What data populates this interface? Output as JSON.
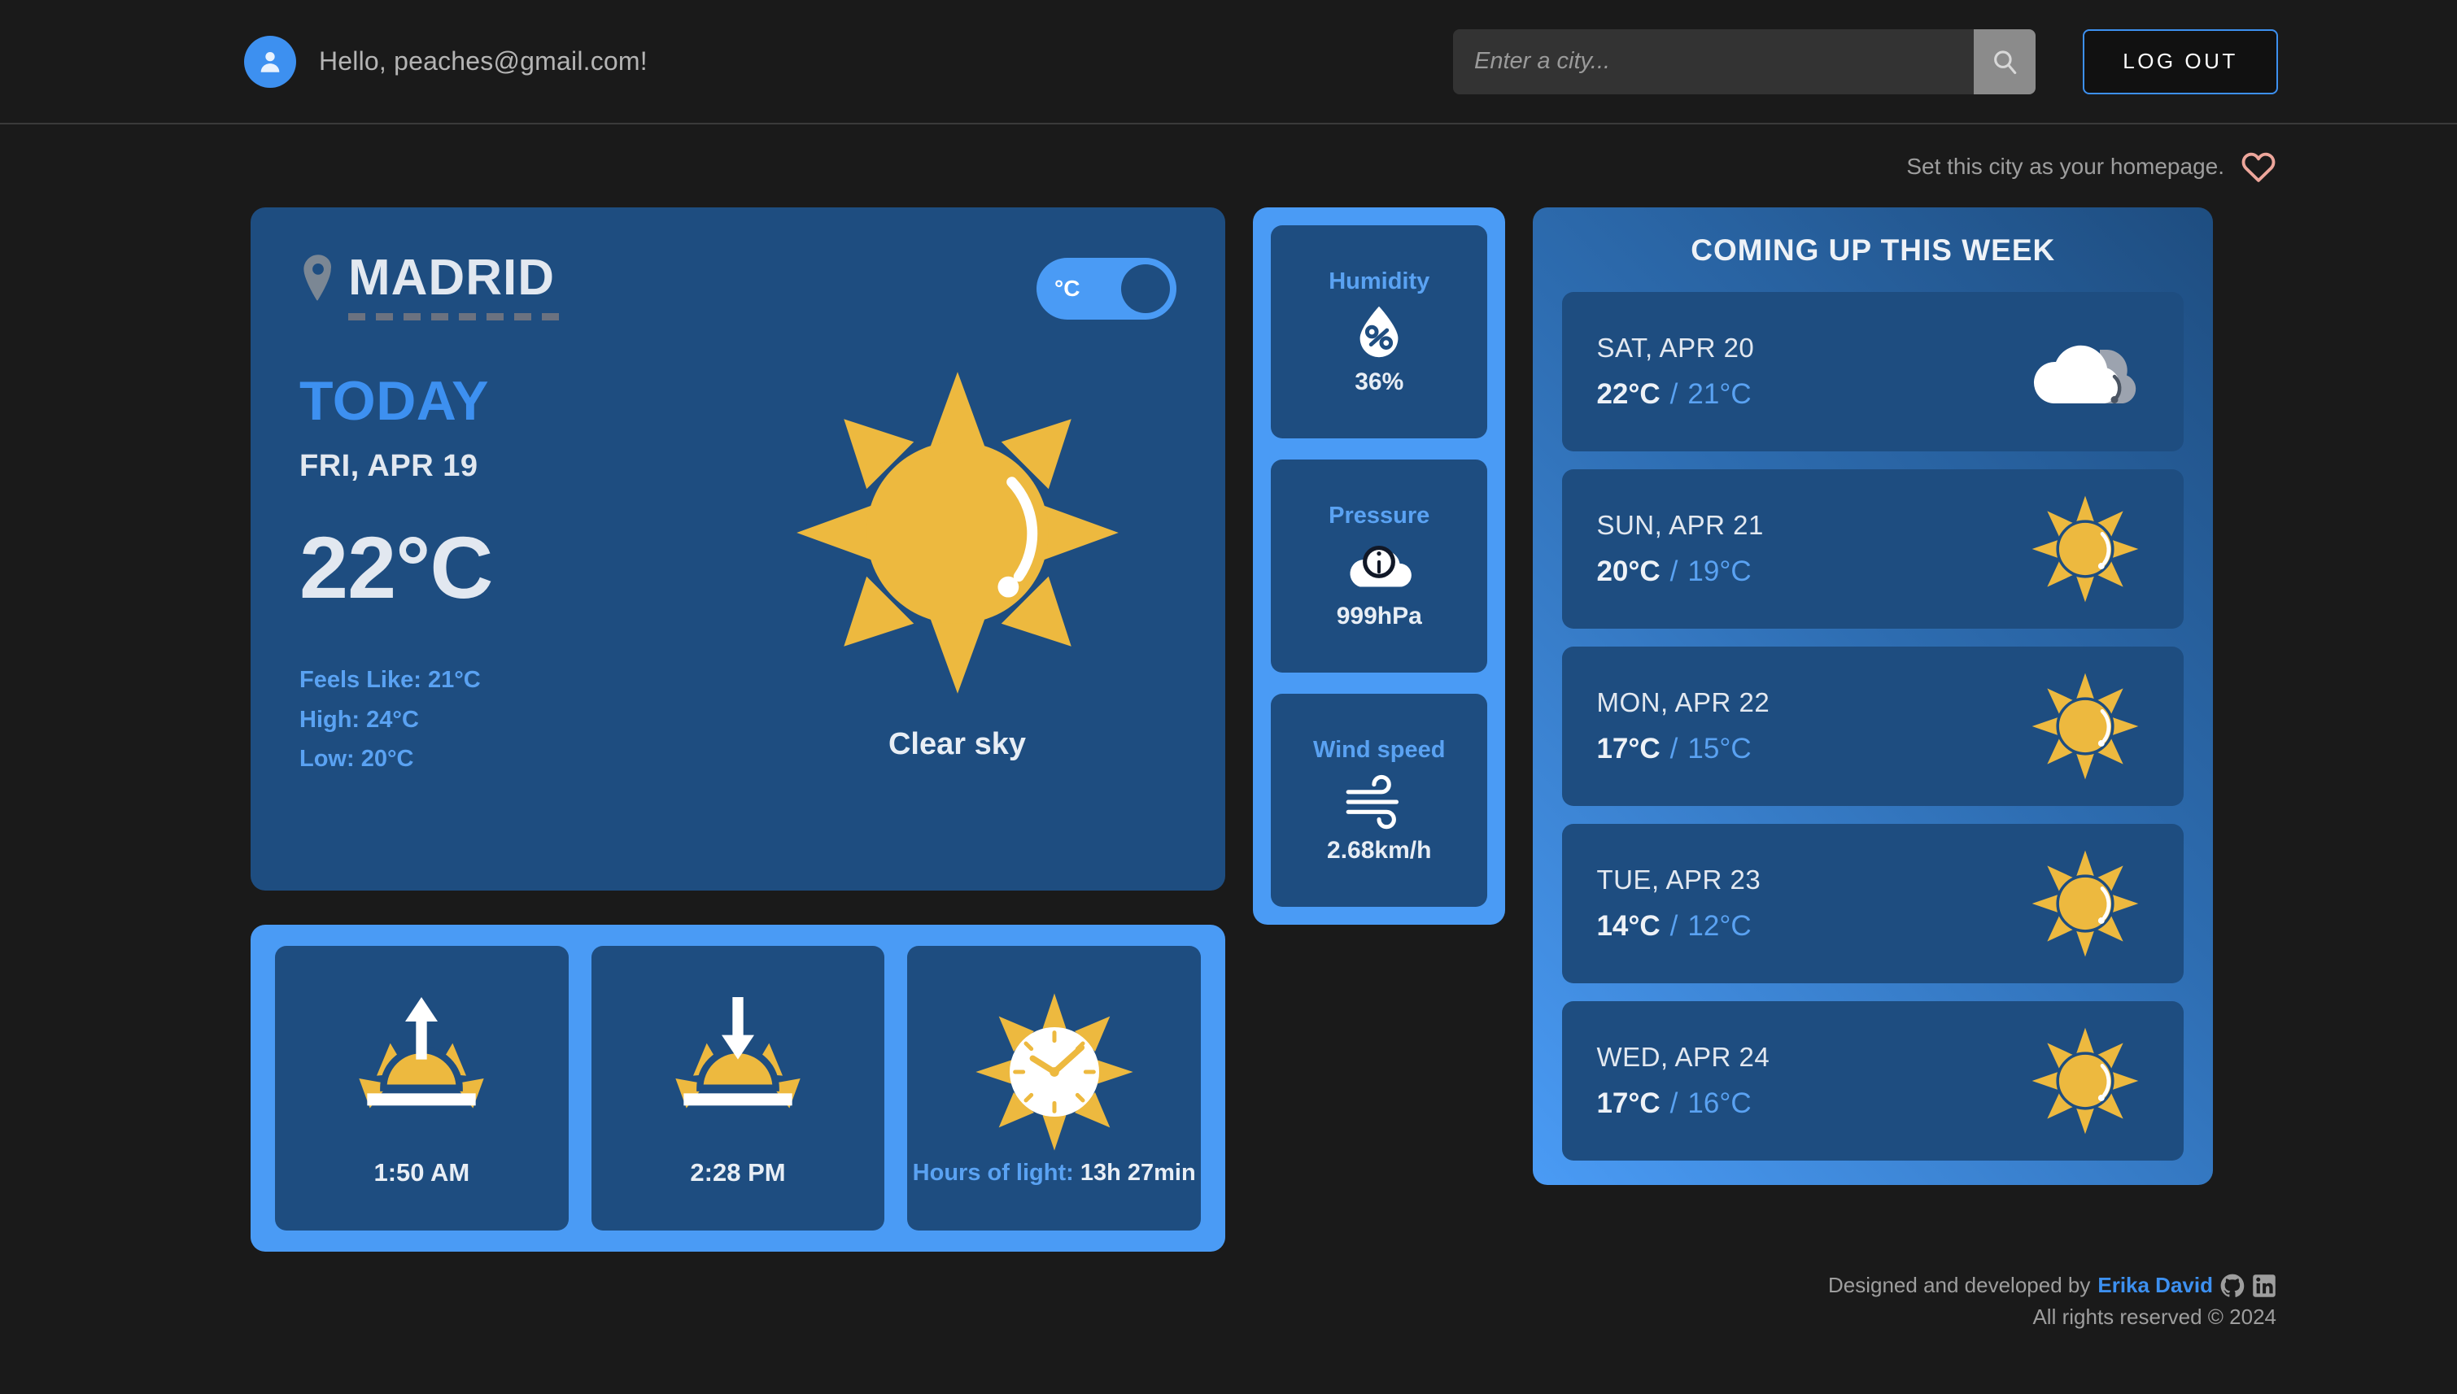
{
  "header": {
    "greeting": "Hello, peaches@gmail.com!",
    "search_placeholder": "Enter a city...",
    "search_value": "",
    "logout_label": "LOG OUT",
    "avatar_icon": "user-icon",
    "search_icon": "search-icon"
  },
  "homepage": {
    "text": "Set this city as your homepage.",
    "heart_icon": "heart-outline-icon",
    "heart_color": "#eda69b"
  },
  "today": {
    "city": "MADRID",
    "pin_icon": "location-pin-icon",
    "label": "TODAY",
    "date": "FRI, APR 19",
    "temperature": "22°C",
    "feels_like": "Feels Like: 21°C",
    "high": "High: 24°C",
    "low": "Low: 20°C",
    "condition": "Clear sky",
    "condition_icon": "sun-icon",
    "unit_toggle_label": "°C",
    "unit_toggle_state": "celsius"
  },
  "sun_times": [
    {
      "icon": "sunrise-icon",
      "value": "1:50 AM",
      "kind": "time"
    },
    {
      "icon": "sunset-icon",
      "value": "2:28 PM",
      "kind": "time"
    },
    {
      "icon": "sun-clock-icon",
      "label": "Hours of light: ",
      "value": "13h 27min",
      "kind": "duration"
    }
  ],
  "stats": [
    {
      "title": "Humidity",
      "icon": "humidity-drop-icon",
      "value": "36%"
    },
    {
      "title": "Pressure",
      "icon": "pressure-cloud-icon",
      "value": "999hPa"
    },
    {
      "title": "Wind speed",
      "icon": "wind-icon",
      "value": "2.68km/h"
    }
  ],
  "week": {
    "title": "COMING UP THIS WEEK",
    "days": [
      {
        "day": "SAT, APR 20",
        "max": "22°C",
        "sep": "/",
        "min": "21°C",
        "icon": "cloud-icon"
      },
      {
        "day": "SUN, APR 21",
        "max": "20°C",
        "sep": "/",
        "min": "19°C",
        "icon": "sun-icon"
      },
      {
        "day": "MON, APR 22",
        "max": "17°C",
        "sep": "/",
        "min": "15°C",
        "icon": "sun-icon"
      },
      {
        "day": "TUE, APR 23",
        "max": "14°C",
        "sep": "/",
        "min": "12°C",
        "icon": "sun-icon"
      },
      {
        "day": "WED, APR 24",
        "max": "17°C",
        "sep": "/",
        "min": "16°C",
        "icon": "sun-icon"
      }
    ]
  },
  "footer": {
    "credit_prefix": "Designed and developed by ",
    "author": "Erika David",
    "github_icon": "github-icon",
    "linkedin_icon": "linkedin-icon",
    "rights": "All rights reserved © 2024"
  },
  "colors": {
    "background": "#1a1a1a",
    "card_blue": "#1e4d80",
    "panel_blue": "#4a9bf5",
    "accent_blue": "#3d90f0",
    "sun_yellow": "#edb93f",
    "text_light": "#e2e8f0"
  }
}
